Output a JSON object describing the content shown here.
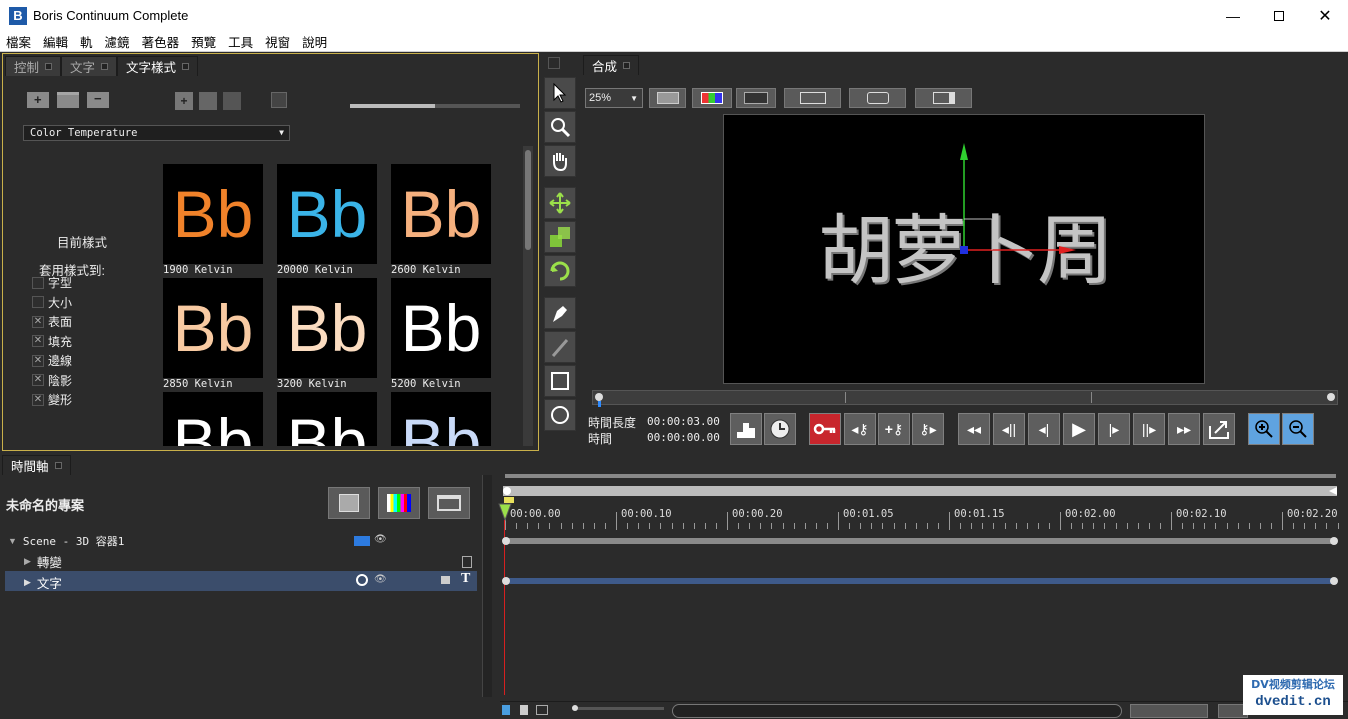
{
  "window": {
    "title": "Boris Continuum Complete",
    "logo_letter": "B"
  },
  "menu": [
    "檔案",
    "編輯",
    "軌",
    "濾鏡",
    "著色器",
    "預覽",
    "工具",
    "視窗",
    "說明"
  ],
  "left_panel": {
    "tabs": [
      "控制",
      "文字",
      "文字樣式"
    ],
    "preset_dropdown": "Color Temperature",
    "current_style_label": "目前樣式",
    "apply_to_label": "套用樣式到:",
    "apply_options": [
      {
        "label": "字型",
        "checked": false
      },
      {
        "label": "大小",
        "checked": false
      },
      {
        "label": "表面",
        "checked": true
      },
      {
        "label": "填充",
        "checked": true
      },
      {
        "label": "邊線",
        "checked": true
      },
      {
        "label": "陰影",
        "checked": true
      },
      {
        "label": "變形",
        "checked": true
      }
    ],
    "swatch_text": "Bb",
    "swatches": [
      {
        "label": "1900 Kelvin",
        "color": "#f0822a"
      },
      {
        "label": "20000 Kelvin",
        "color": "#3ab4e8"
      },
      {
        "label": "2600 Kelvin",
        "color": "#f5b07e"
      },
      {
        "label": "2850 Kelvin",
        "color": "#f8caa2"
      },
      {
        "label": "3200 Kelvin",
        "color": "#fbdcc0"
      },
      {
        "label": "5200 Kelvin",
        "color": "#ffffff"
      },
      {
        "label": "",
        "color": "#ffffff"
      },
      {
        "label": "",
        "color": "#ffffff"
      },
      {
        "label": "",
        "color": "#c9daf8"
      }
    ]
  },
  "composite": {
    "tab": "合成",
    "zoom": "25%",
    "canvas_text": "胡萝卜周",
    "duration_label": "時間長度",
    "duration_value": "00:00:03.00",
    "time_label": "時間",
    "time_value": "00:00:00.00"
  },
  "timeline": {
    "tab": "時間軸",
    "project_name": "未命名的專案",
    "tracks": [
      {
        "label": "Scene - 3D 容器1",
        "level": 0
      },
      {
        "label": "轉變",
        "level": 1
      },
      {
        "label": "文字",
        "level": 1
      }
    ],
    "ruler": [
      "00:00.00",
      "00:00.10",
      "00:00.20",
      "00:01.05",
      "00:01.15",
      "00:02.00",
      "00:02.10",
      "00:02.20"
    ]
  },
  "watermark": {
    "line1": "DV视频剪辑论坛",
    "line2": "dvedit.cn"
  }
}
